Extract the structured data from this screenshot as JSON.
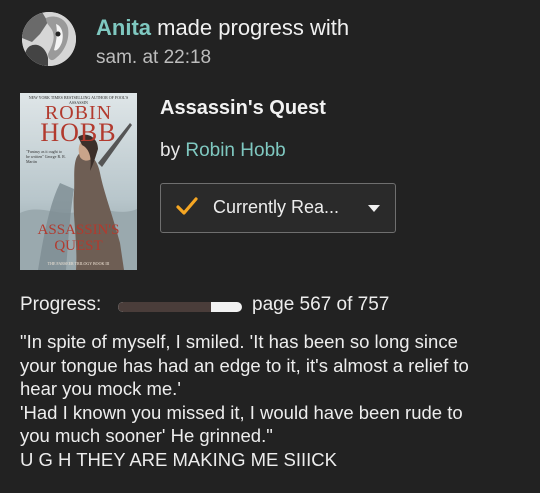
{
  "update": {
    "user_name": "Anita",
    "action_text": " made progress with",
    "timestamp": "sam. at 22:18"
  },
  "book": {
    "title": "Assassin's Quest",
    "by_label": "by ",
    "author": "Robin Hobb",
    "cover": {
      "top_tagline": "NEW YORK TIMES BESTSELLING AUTHOR OF FOOL'S ASSASSIN",
      "author_first": "ROBIN",
      "author_last": "HOBB",
      "blurb": "\"Fantasy as it ought to be written\" George R. R. Martin",
      "title_line1": "ASSASSIN'S",
      "title_line2": "QUEST",
      "footer": "THE FARSEER TRILOGY BOOK III"
    }
  },
  "shelf_button": {
    "icon": "checkmark-icon",
    "label": "Currently Rea...",
    "accent_color": "#f5a623"
  },
  "progress": {
    "label": "Progress:",
    "current_page": 567,
    "total_pages": 757,
    "fraction": 0.749,
    "text": "page 567 of 757"
  },
  "comment": {
    "lines": [
      "\"In spite of myself, I smiled. 'It has been so long since",
      "your tongue has had an edge to it, it's almost a relief to",
      "hear you mock me.'",
      "'Had I known you missed it, I would have been rude to",
      "you much sooner' He grinned.\"",
      "U G H THEY ARE MAKING ME SIIICK"
    ]
  }
}
